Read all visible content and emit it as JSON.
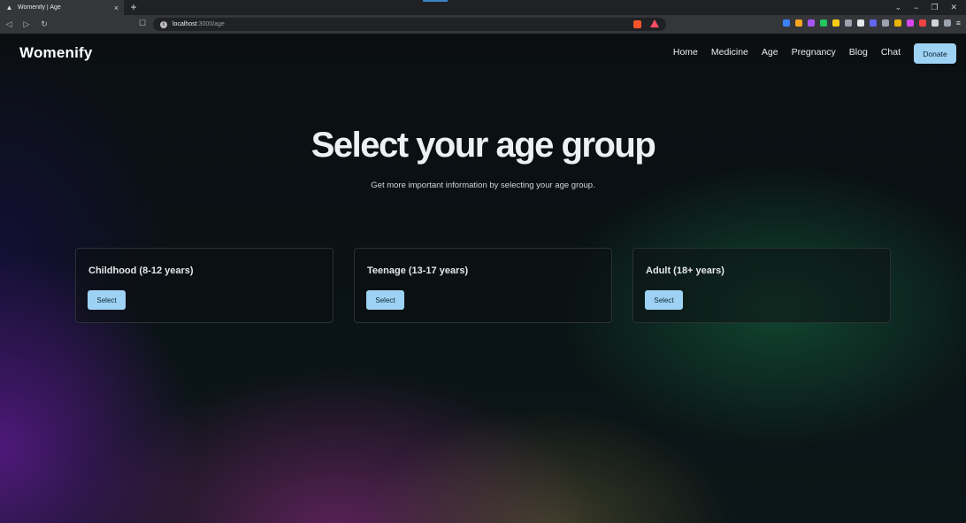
{
  "browser": {
    "tab_title": "Womenify | Age",
    "tab_close": "×",
    "new_tab": "+",
    "url_host": "localhost",
    "url_path": ":3000/age",
    "win_min": "−",
    "win_restore": "❐",
    "win_close": "✕",
    "win_dropdown": "⌄",
    "back": "◁",
    "forward": "▷",
    "reload": "↻",
    "bookmark": "☐",
    "extension_colors": [
      "#3b82f6",
      "#f5a623",
      "#a855f7",
      "#22c55e",
      "#facc15",
      "#9ca3af",
      "#e5e7eb",
      "#6366f1",
      "#9ca3af",
      "#eab308",
      "#d946ef",
      "#ef4444",
      "#d1d5db",
      "#9ca3af"
    ]
  },
  "nav": {
    "brand": "Womenify",
    "items": [
      "Home",
      "Medicine",
      "Age",
      "Pregnancy",
      "Blog",
      "Chat"
    ],
    "donate_label": "Donate"
  },
  "hero": {
    "title": "Select your age group",
    "subtitle": "Get more important information by selecting your age group."
  },
  "cards": [
    {
      "title": "Childhood (8-12 years)",
      "button": "Select"
    },
    {
      "title": "Teenage (13-17 years)",
      "button": "Select"
    },
    {
      "title": "Adult (18+ years)",
      "button": "Select"
    }
  ],
  "colors": {
    "accent": "#9ed2f5",
    "background": "#0b0f12"
  }
}
